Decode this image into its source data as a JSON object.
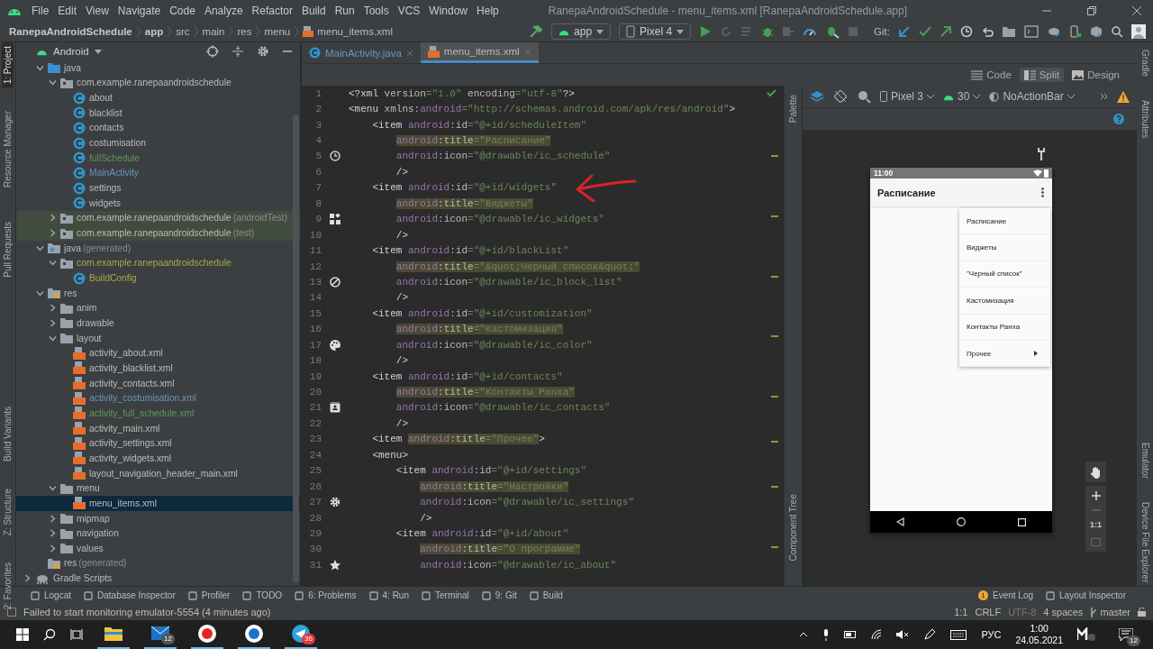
{
  "menu_bar": {
    "items": [
      "File",
      "Edit",
      "View",
      "Navigate",
      "Code",
      "Analyze",
      "Refactor",
      "Build",
      "Run",
      "Tools",
      "VCS",
      "Window",
      "Help"
    ],
    "title": "RanepaAndroidSchedule - menu_items.xml [RanepaAndroidSchedule.app]"
  },
  "breadcrumb": [
    "RanepaAndroidSchedule",
    "app",
    "src",
    "main",
    "res",
    "menu",
    "menu_items.xml"
  ],
  "toolbar": {
    "run_config": "app",
    "device": "Pixel 4",
    "git_label": "Git:"
  },
  "left_tool_windows": [
    {
      "label": "1: Project",
      "selected": true
    },
    {
      "label": "Resource Manager",
      "selected": false
    },
    {
      "label": "Pull Requests",
      "selected": false
    },
    {
      "label": "Build Variants",
      "selected": false
    },
    {
      "label": "Z: Structure",
      "selected": false
    },
    {
      "label": "2: Favorites",
      "selected": false
    }
  ],
  "project": {
    "view": "Android",
    "items": [
      {
        "label": "java",
        "kind": "source-folder",
        "expanded": true,
        "selected": false,
        "children": [
          {
            "label": "com.example.ranepaandroidschedule",
            "kind": "package",
            "expanded": true,
            "selected": false,
            "test_scope": false,
            "children": [
              {
                "label": "about",
                "kind": "class",
                "selected": false,
                "color": "#bbbbbb"
              },
              {
                "label": "blacklist",
                "kind": "class",
                "selected": false,
                "color": "#bbbbbb"
              },
              {
                "label": "contacts",
                "kind": "class",
                "selected": false,
                "color": "#bbbbbb"
              },
              {
                "label": "costumisation",
                "kind": "class",
                "selected": false,
                "color": "#bbbbbb"
              },
              {
                "label": "fullSchedule",
                "kind": "class",
                "selected": false,
                "color": "#629755"
              },
              {
                "label": "MainActivity",
                "kind": "class",
                "selected": false,
                "color": "#6897bb"
              },
              {
                "label": "settings",
                "kind": "class",
                "selected": false,
                "color": "#bbbbbb"
              },
              {
                "label": "widgets",
                "kind": "class",
                "selected": false,
                "color": "#bbbbbb"
              }
            ]
          },
          {
            "label": "com.example.ranepaandroidschedule",
            "note": "(androidTest)",
            "kind": "package",
            "expanded": false,
            "selected": false,
            "test_scope": true
          },
          {
            "label": "com.example.ranepaandroidschedule",
            "note": "(test)",
            "kind": "package",
            "expanded": false,
            "selected": false,
            "test_scope": true
          }
        ]
      },
      {
        "label": "java",
        "note": "(generated)",
        "kind": "generated-folder",
        "expanded": true,
        "selected": false,
        "children": [
          {
            "label": "com.example.ranepaandroidschedule",
            "kind": "package",
            "expanded": true,
            "selected": false,
            "color": "#a8a84a",
            "children": [
              {
                "label": "BuildConfig",
                "kind": "class",
                "selected": false,
                "color": "#a8a84a"
              }
            ]
          }
        ]
      },
      {
        "label": "res",
        "kind": "res-folder",
        "expanded": true,
        "selected": false,
        "children": [
          {
            "label": "anim",
            "kind": "folder",
            "expanded": false,
            "selected": false
          },
          {
            "label": "drawable",
            "kind": "folder",
            "expanded": false,
            "selected": false
          },
          {
            "label": "layout",
            "kind": "folder",
            "expanded": true,
            "selected": false,
            "children": [
              {
                "label": "activity_about.xml",
                "kind": "xml",
                "selected": false,
                "color": "#bbbbbb"
              },
              {
                "label": "activity_blacklist.xml",
                "kind": "xml",
                "selected": false,
                "color": "#bbbbbb"
              },
              {
                "label": "activity_contacts.xml",
                "kind": "xml",
                "selected": false,
                "color": "#bbbbbb"
              },
              {
                "label": "activity_costumisation.xml",
                "kind": "xml",
                "selected": false,
                "color": "#6897bb"
              },
              {
                "label": "activity_full_schedule.xml",
                "kind": "xml",
                "selected": false,
                "color": "#629755"
              },
              {
                "label": "activity_main.xml",
                "kind": "xml",
                "selected": false,
                "color": "#bbbbbb"
              },
              {
                "label": "activity_settings.xml",
                "kind": "xml",
                "selected": false,
                "color": "#bbbbbb"
              },
              {
                "label": "activity_widgets.xml",
                "kind": "xml",
                "selected": false,
                "color": "#bbbbbb"
              },
              {
                "label": "layout_navigation_header_main.xml",
                "kind": "xml",
                "selected": false,
                "color": "#bbbbbb"
              }
            ]
          },
          {
            "label": "menu",
            "kind": "folder",
            "expanded": true,
            "selected": false,
            "children": [
              {
                "label": "menu_items.xml",
                "kind": "xml",
                "selected": true
              }
            ]
          },
          {
            "label": "mipmap",
            "kind": "folder",
            "expanded": false,
            "selected": false
          },
          {
            "label": "navigation",
            "kind": "folder",
            "expanded": false,
            "selected": false
          },
          {
            "label": "values",
            "kind": "folder",
            "expanded": false,
            "selected": false
          }
        ]
      },
      {
        "label": "res",
        "note": "(generated)",
        "kind": "res-folder",
        "selected": false
      }
    ],
    "root_items": [
      {
        "label": "Gradle Scripts",
        "kind": "gradle",
        "expanded": false,
        "selected": false
      }
    ]
  },
  "editor_tabs": [
    {
      "label": "MainActivity.java",
      "kind": "class",
      "selected": false
    },
    {
      "label": "menu_items.xml",
      "kind": "xml",
      "selected": true
    }
  ],
  "view_modes": [
    {
      "label": "Code",
      "selected": false
    },
    {
      "label": "Split",
      "selected": true
    },
    {
      "label": "Design",
      "selected": false
    }
  ],
  "code_lines": [
    {
      "number": "1",
      "parts": [
        {
          "text": "<?xml ",
          "kind": "tag"
        },
        {
          "text": "version",
          "kind": "attr"
        },
        {
          "text": "=\"1.0\" ",
          "kind": "str"
        },
        {
          "text": "encoding",
          "kind": "attr"
        },
        {
          "text": "=\"utf-8\"",
          "kind": "str"
        },
        {
          "text": "?>",
          "kind": "tag"
        }
      ]
    },
    {
      "number": "2",
      "parts": [
        {
          "text": "<menu ",
          "kind": "tag"
        },
        {
          "text": "xmlns:",
          "kind": "attr"
        },
        {
          "text": "android",
          "kind": "ns"
        },
        {
          "text": "=\"http://schemas.android.com/apk/res/android\"",
          "kind": "str"
        },
        {
          "text": ">",
          "kind": "tag"
        }
      ]
    },
    {
      "number": "3",
      "parts": [
        {
          "text": "    <item ",
          "kind": "tag"
        },
        {
          "text": "android",
          "kind": "ns"
        },
        {
          "text": ":id",
          "kind": "attr"
        },
        {
          "text": "=\"@+id/scheduleItem\"",
          "kind": "str"
        }
      ]
    },
    {
      "number": "4",
      "parts": [
        {
          "text": "        android",
          "kind": "wns"
        },
        {
          "text": ":title",
          "kind": "wattr"
        },
        {
          "text": "=\"Расписание\"",
          "kind": "wstr"
        }
      ]
    },
    {
      "number": "5",
      "kind": "clock",
      "parts": [
        {
          "text": "        android",
          "kind": "ns"
        },
        {
          "text": ":icon",
          "kind": "attr"
        },
        {
          "text": "=\"@drawable/ic_schedule\"",
          "kind": "str"
        }
      ]
    },
    {
      "number": "6",
      "parts": [
        {
          "text": "        />",
          "kind": "tag"
        }
      ]
    },
    {
      "number": "7",
      "parts": [
        {
          "text": "    <item ",
          "kind": "tag"
        },
        {
          "text": "android",
          "kind": "ns"
        },
        {
          "text": ":id",
          "kind": "attr"
        },
        {
          "text": "=\"@+id/widgets\"",
          "kind": "str"
        }
      ]
    },
    {
      "number": "8",
      "parts": [
        {
          "text": "        android",
          "kind": "wns"
        },
        {
          "text": ":title",
          "kind": "wattr"
        },
        {
          "text": "=\"Виджеты\"",
          "kind": "wstr"
        }
      ]
    },
    {
      "number": "9",
      "kind": "widgets",
      "parts": [
        {
          "text": "        android",
          "kind": "ns"
        },
        {
          "text": ":icon",
          "kind": "attr"
        },
        {
          "text": "=\"@drawable/ic_widgets\"",
          "kind": "str"
        }
      ]
    },
    {
      "number": "10",
      "parts": [
        {
          "text": "        />",
          "kind": "tag"
        }
      ]
    },
    {
      "number": "11",
      "parts": [
        {
          "text": "    <item ",
          "kind": "tag"
        },
        {
          "text": "android",
          "kind": "ns"
        },
        {
          "text": ":id",
          "kind": "attr"
        },
        {
          "text": "=\"@+id/blackList\"",
          "kind": "str"
        }
      ]
    },
    {
      "number": "12",
      "parts": [
        {
          "text": "        android",
          "kind": "wns"
        },
        {
          "text": ":title",
          "kind": "wattr"
        },
        {
          "text": "=\"&quot;Черный список&quot;\"",
          "kind": "wstr"
        }
      ]
    },
    {
      "number": "13",
      "kind": "block",
      "parts": [
        {
          "text": "        android",
          "kind": "ns"
        },
        {
          "text": ":icon",
          "kind": "attr"
        },
        {
          "text": "=\"@drawable/ic_block_list\"",
          "kind": "str"
        }
      ]
    },
    {
      "number": "14",
      "parts": [
        {
          "text": "        />",
          "kind": "tag"
        }
      ]
    },
    {
      "number": "15",
      "parts": [
        {
          "text": "    <item ",
          "kind": "tag"
        },
        {
          "text": "android",
          "kind": "ns"
        },
        {
          "text": ":id",
          "kind": "attr"
        },
        {
          "text": "=\"@+id/customization\"",
          "kind": "str"
        }
      ]
    },
    {
      "number": "16",
      "parts": [
        {
          "text": "        android",
          "kind": "wns"
        },
        {
          "text": ":title",
          "kind": "wattr"
        },
        {
          "text": "=\"Кастомизация\"",
          "kind": "wstr"
        }
      ]
    },
    {
      "number": "17",
      "kind": "palette",
      "parts": [
        {
          "text": "        android",
          "kind": "ns"
        },
        {
          "text": ":icon",
          "kind": "attr"
        },
        {
          "text": "=\"@drawable/ic_color\"",
          "kind": "str"
        }
      ]
    },
    {
      "number": "18",
      "parts": [
        {
          "text": "        />",
          "kind": "tag"
        }
      ]
    },
    {
      "number": "19",
      "parts": [
        {
          "text": "    <item ",
          "kind": "tag"
        },
        {
          "text": "android",
          "kind": "ns"
        },
        {
          "text": ":id",
          "kind": "attr"
        },
        {
          "text": "=\"@+id/contacts\"",
          "kind": "str"
        }
      ]
    },
    {
      "number": "20",
      "parts": [
        {
          "text": "        android",
          "kind": "wns"
        },
        {
          "text": ":title",
          "kind": "wattr"
        },
        {
          "text": "=\"Контакты Ранха\"",
          "kind": "wstr"
        }
      ]
    },
    {
      "number": "21",
      "kind": "contacts",
      "parts": [
        {
          "text": "        android",
          "kind": "ns"
        },
        {
          "text": ":icon",
          "kind": "attr"
        },
        {
          "text": "=\"@drawable/ic_contacts\"",
          "kind": "str"
        }
      ]
    },
    {
      "number": "22",
      "parts": [
        {
          "text": "        />",
          "kind": "tag"
        }
      ]
    },
    {
      "number": "23",
      "parts": [
        {
          "text": "    <item ",
          "kind": "tag"
        },
        {
          "text": "android",
          "kind": "wns"
        },
        {
          "text": ":title",
          "kind": "wattr"
        },
        {
          "text": "=\"Прочее\"",
          "kind": "wstr"
        },
        {
          "text": ">",
          "kind": "tag"
        }
      ]
    },
    {
      "number": "24",
      "parts": [
        {
          "text": "    <menu>",
          "kind": "tag"
        }
      ]
    },
    {
      "number": "25",
      "parts": [
        {
          "text": "        <item ",
          "kind": "tag"
        },
        {
          "text": "android",
          "kind": "ns"
        },
        {
          "text": ":id",
          "kind": "attr"
        },
        {
          "text": "=\"@+id/settings\"",
          "kind": "str"
        }
      ]
    },
    {
      "number": "26",
      "parts": [
        {
          "text": "            android",
          "kind": "wns"
        },
        {
          "text": ":title",
          "kind": "wattr"
        },
        {
          "text": "=\"Настройки\"",
          "kind": "wstr"
        }
      ]
    },
    {
      "number": "27",
      "kind": "gear",
      "parts": [
        {
          "text": "            android",
          "kind": "ns"
        },
        {
          "text": ":icon",
          "kind": "attr"
        },
        {
          "text": "=\"@drawable/ic_settings\"",
          "kind": "str"
        }
      ]
    },
    {
      "number": "28",
      "parts": [
        {
          "text": "            />",
          "kind": "tag"
        }
      ]
    },
    {
      "number": "29",
      "parts": [
        {
          "text": "        <item ",
          "kind": "tag"
        },
        {
          "text": "android",
          "kind": "ns"
        },
        {
          "text": ":id",
          "kind": "attr"
        },
        {
          "text": "=\"@+id/about\"",
          "kind": "str"
        }
      ]
    },
    {
      "number": "30",
      "parts": [
        {
          "text": "            android",
          "kind": "wns"
        },
        {
          "text": ":title",
          "kind": "wattr"
        },
        {
          "text": "=\"О программе\"",
          "kind": "wstr"
        }
      ]
    },
    {
      "number": "31",
      "kind": "star",
      "parts": [
        {
          "text": "            android",
          "kind": "ns"
        },
        {
          "text": ":icon",
          "kind": "attr"
        },
        {
          "text": "=\"@drawable/ic_about\"",
          "kind": "str"
        }
      ]
    }
  ],
  "design": {
    "side_labels": [
      "Palette",
      "Component Tree"
    ],
    "device": "Pixel 3",
    "api": "30",
    "theme": "NoActionBar",
    "zoom_label": "1:1",
    "phone": {
      "time": "11:00",
      "title": "Расписание",
      "menu": [
        {
          "label": "Расписание",
          "submenu": false
        },
        {
          "label": "Виджеты",
          "submenu": false
        },
        {
          "label": "\"Черный список\"",
          "submenu": false
        },
        {
          "label": "Кастомизация",
          "submenu": false
        },
        {
          "label": "Контакты Ранха",
          "submenu": false
        },
        {
          "label": "Прочее",
          "submenu": true
        }
      ]
    }
  },
  "right_tool_windows": [
    "Gradle",
    "Attributes",
    "Emulator",
    "Device File Explorer"
  ],
  "bottom_tools": [
    "Logcat",
    "Database Inspector",
    "Profiler",
    "TODO",
    "6: Problems",
    "4: Run",
    "Terminal",
    "9: Git",
    "Build"
  ],
  "bottom_right_tools": [
    {
      "label": "Event Log",
      "badge": "1"
    },
    {
      "label": "Layout Inspector"
    }
  ],
  "status_bar": {
    "message": "Failed to start monitoring emulator-5554 (4 minutes ago)",
    "position": "1:1",
    "line_separator": "CRLF",
    "encoding": "UTF-8",
    "indent": "4 spaces",
    "branch": "master"
  },
  "taskbar": {
    "mail_badge": "12",
    "telegram_badge": "36",
    "language": "РУС",
    "time": "1:00",
    "date": "24.05.2021",
    "notifications": "12"
  }
}
